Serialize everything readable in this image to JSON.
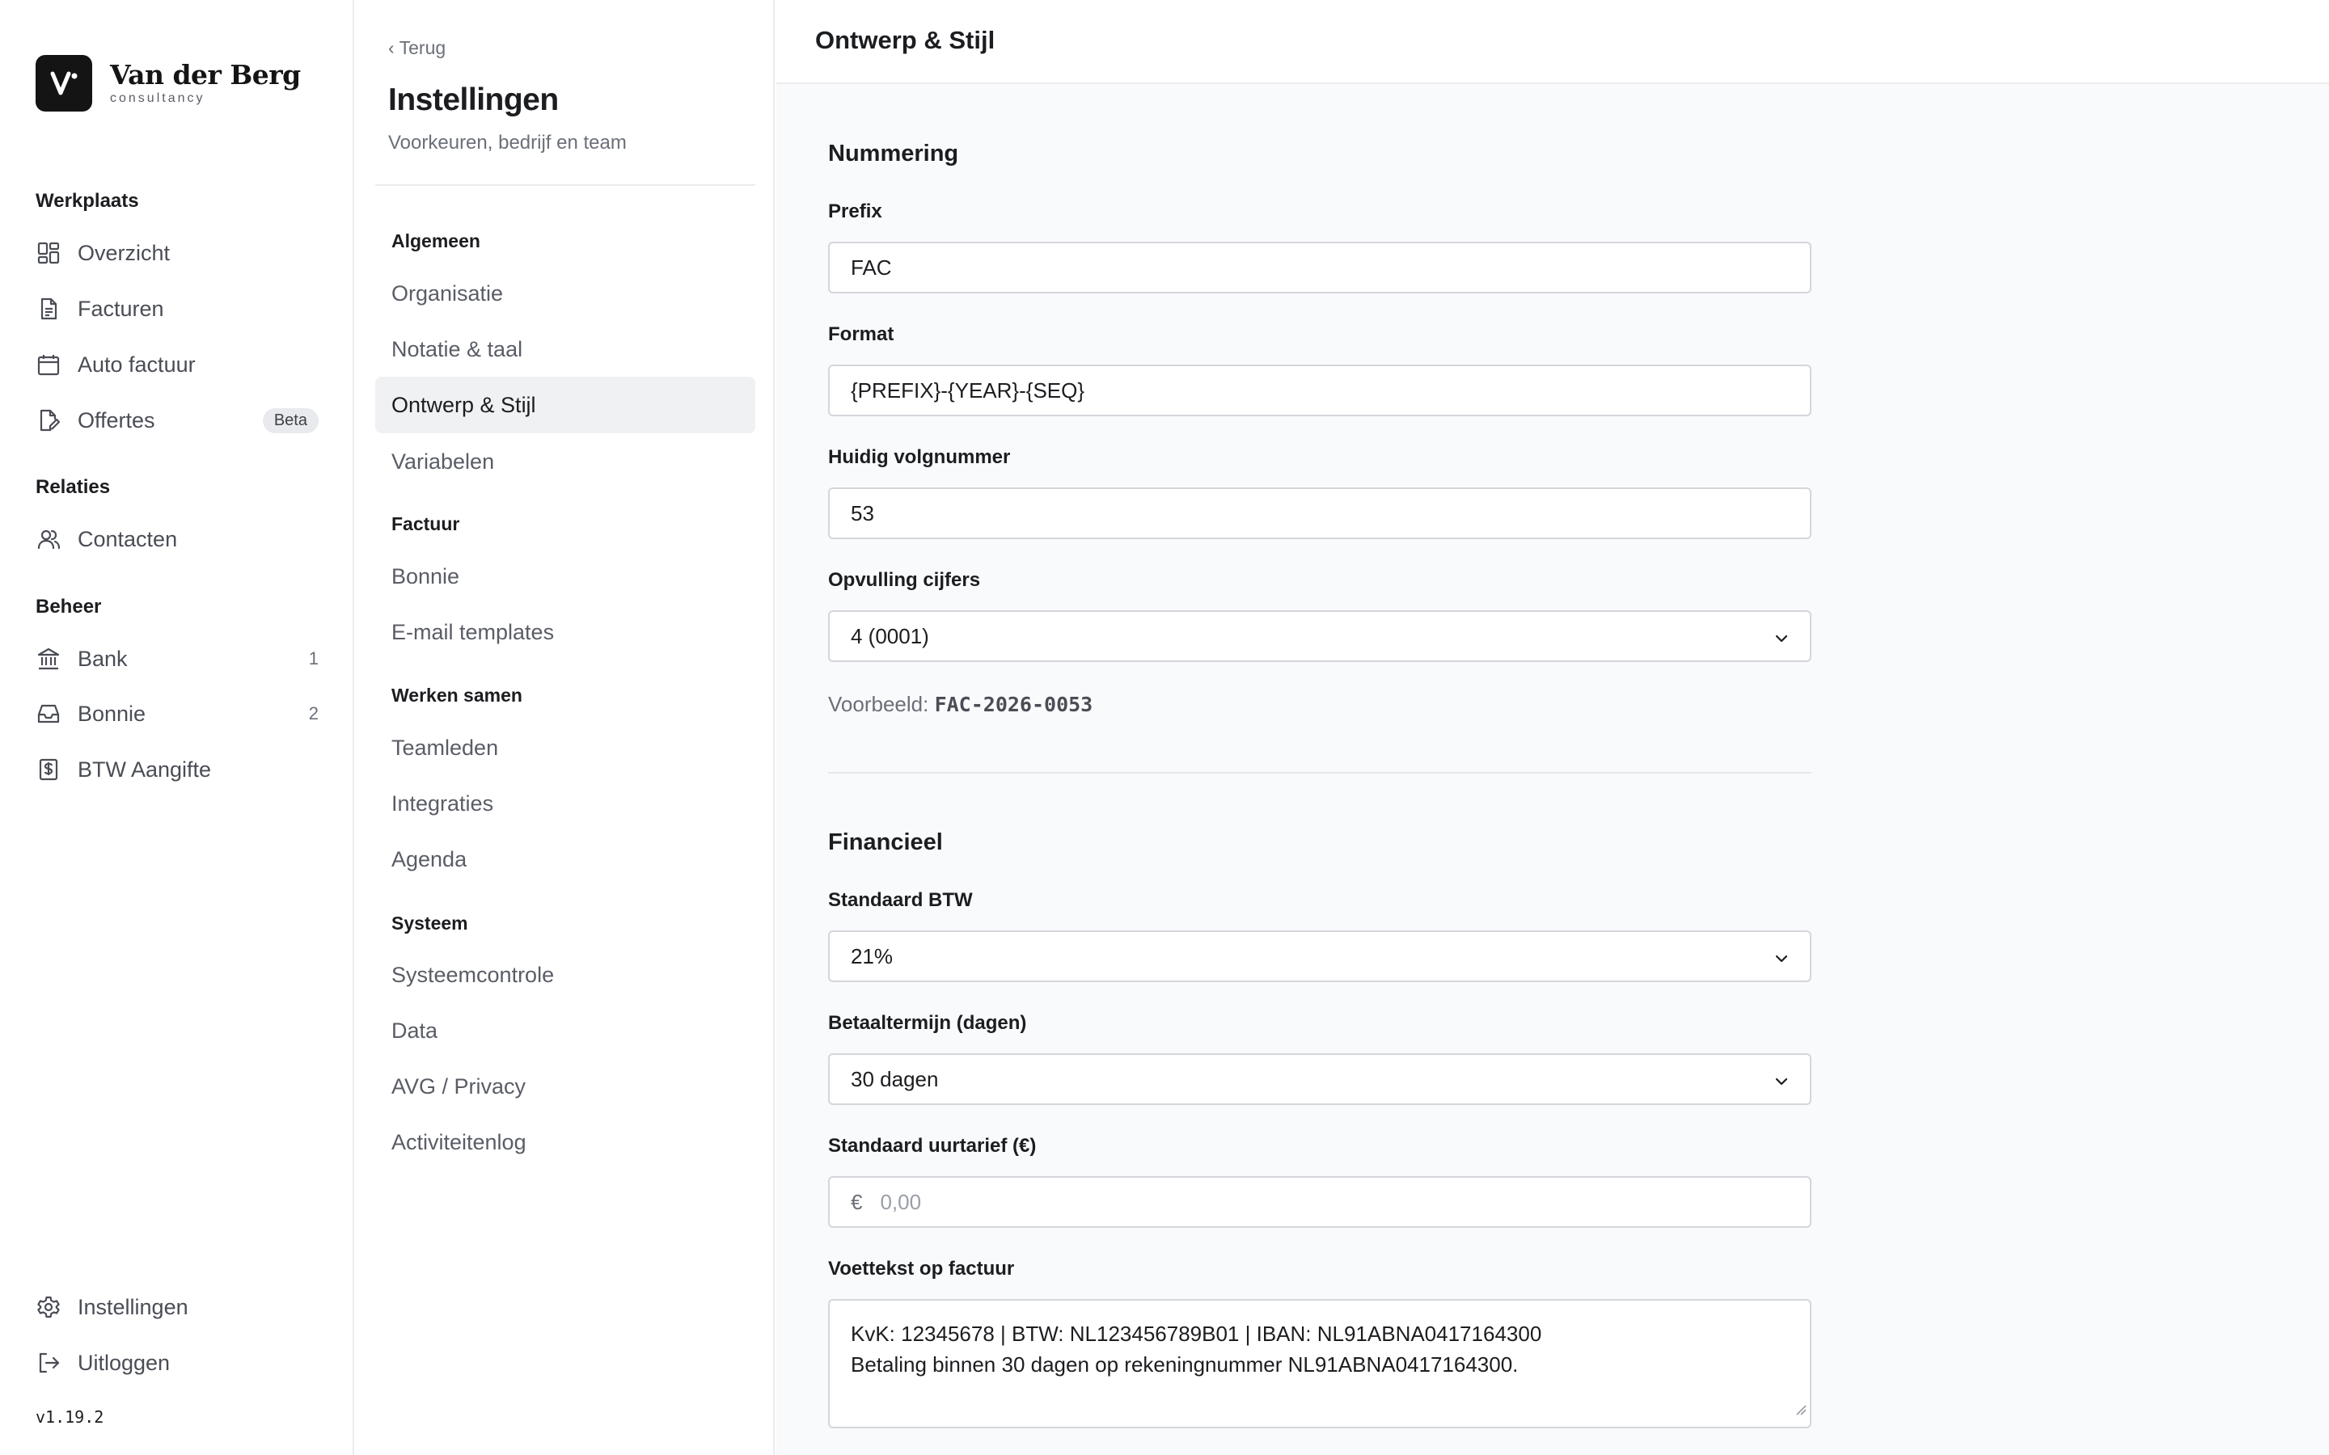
{
  "brand": {
    "name": "Van der Berg",
    "sub": "consultancy"
  },
  "nav": {
    "sections": {
      "workspace": "Werkplaats",
      "relations": "Relaties",
      "manage": "Beheer"
    },
    "items": {
      "overview": "Overzicht",
      "invoices": "Facturen",
      "auto_invoice": "Auto factuur",
      "quotes": "Offertes",
      "quotes_badge": "Beta",
      "contacts": "Contacten",
      "bank": "Bank",
      "bank_count": "1",
      "receipts": "Bonnie",
      "receipts_count": "2",
      "vat": "BTW Aangifte",
      "settings": "Instellingen",
      "logout": "Uitloggen"
    },
    "version": "v1.19.2"
  },
  "settings": {
    "back": "‹ Terug",
    "title": "Instellingen",
    "subtitle": "Voorkeuren, bedrijf en team",
    "groups": {
      "general": "Algemeen",
      "invoice": "Factuur",
      "team": "Werken samen",
      "system": "Systeem"
    },
    "items": {
      "organisation": "Organisatie",
      "notation": "Notatie & taal",
      "design": "Ontwerp & Stijl",
      "variables": "Variabelen",
      "receipts": "Bonnie",
      "email_templates": "E-mail templates",
      "team_members": "Teamleden",
      "integrations": "Integraties",
      "agenda": "Agenda",
      "system_check": "Systeemcontrole",
      "data": "Data",
      "privacy": "AVG / Privacy",
      "activity_log": "Activiteitenlog"
    }
  },
  "main": {
    "title": "Ontwerp & Stijl",
    "numbering": {
      "title": "Nummering",
      "prefix_label": "Prefix",
      "prefix_value": "FAC",
      "format_label": "Format",
      "format_value": "{PREFIX}-{YEAR}-{SEQ}",
      "seq_label": "Huidig volgnummer",
      "seq_value": "53",
      "padding_label": "Opvulling cijfers",
      "padding_value": "4 (0001)",
      "example_label": "Voorbeeld:",
      "example_value": "FAC-2026-0053"
    },
    "financial": {
      "title": "Financieel",
      "vat_label": "Standaard BTW",
      "vat_value": "21%",
      "term_label": "Betaaltermijn (dagen)",
      "term_value": "30 dagen",
      "rate_label": "Standaard uurtarief (€)",
      "rate_currency": "€",
      "rate_placeholder": "0,00",
      "footer_label": "Voettekst op factuur",
      "footer_line1": "KvK: 12345678 | BTW: NL123456789B01 | IBAN: NL91ABNA0417164300",
      "footer_line2": "Betaling binnen 30 dagen op rekeningnummer NL91ABNA0417164300."
    }
  }
}
